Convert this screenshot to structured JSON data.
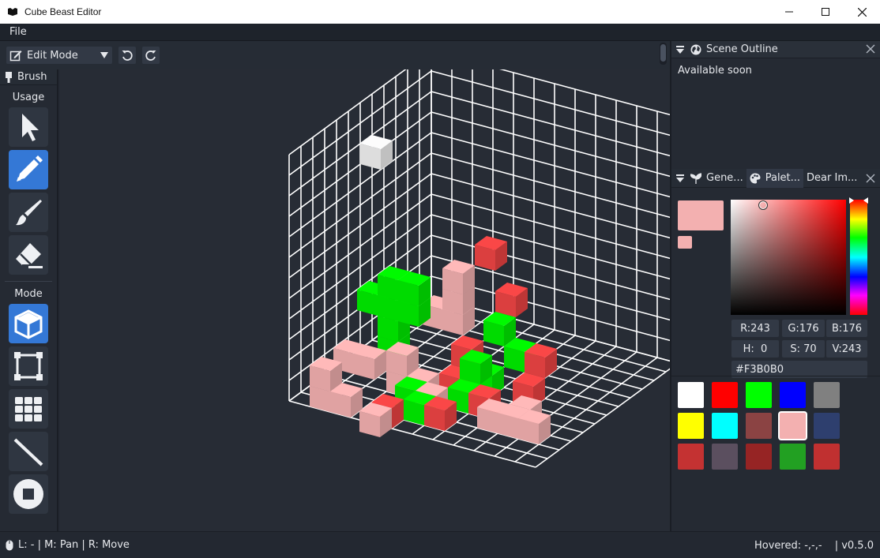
{
  "window": {
    "title": "Cube Beast Editor"
  },
  "menu": {
    "items": [
      "File"
    ]
  },
  "toolbar": {
    "mode_label": "Edit Mode"
  },
  "brush_panel": {
    "title": "Brush",
    "usage_label": "Usage",
    "mode_label": "Mode",
    "usage_tools": [
      "select",
      "pencil",
      "paint",
      "eraser"
    ],
    "active_usage": "pencil",
    "mode_tools": [
      "single-cube",
      "rect-frame",
      "grid-fill",
      "line",
      "circle-stop"
    ],
    "active_mode": "single-cube"
  },
  "scene_outline": {
    "title": "Scene Outline",
    "message": "Available soon"
  },
  "color_panel": {
    "tabs": [
      "Gene...",
      "Palet...",
      "Dear Im..."
    ],
    "active_tab": "Palet...",
    "current_color": "#F3B0B0",
    "r": "R:243",
    "g": "G:176",
    "b": "B:176",
    "h": "H:  0",
    "s": "S: 70",
    "v": "V:243",
    "hex": "#F3B0B0"
  },
  "palette": [
    "#ffffff",
    "#ff0000",
    "#00ff00",
    "#0000ff",
    "#808080",
    "#ffff00",
    "#00ffff",
    "#8b4343",
    "#f3b0b0",
    "#2e3f6e",
    "#c43232",
    "#5b4f5f",
    "#962424",
    "#22a022",
    "#c03030"
  ],
  "palette_selected_index": 8,
  "status": {
    "left": "L: - | M: Pan | R: Move",
    "hovered": "Hovered: -,-,-",
    "version": "| v0.5.0"
  },
  "colors": {
    "accent": "#3478d6",
    "background": "#252a33",
    "voxel_green": "#00ee00",
    "voxel_red": "#ee4444",
    "voxel_pink": "#f3b0b0",
    "voxel_white": "#f0f0f0"
  }
}
